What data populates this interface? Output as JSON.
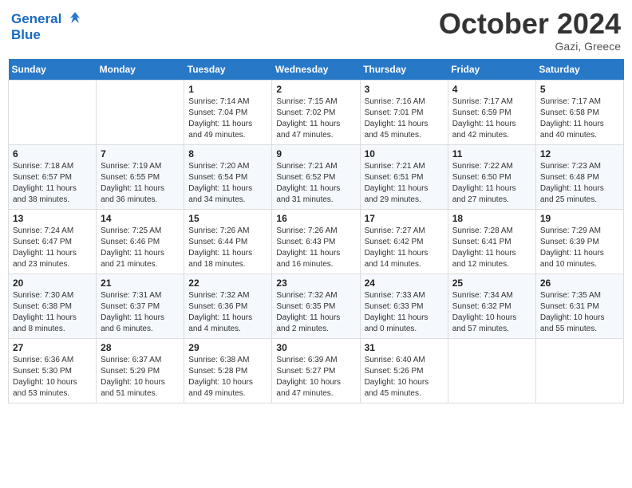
{
  "header": {
    "logo_line1": "General",
    "logo_line2": "Blue",
    "month": "October 2024",
    "location": "Gazi, Greece"
  },
  "weekdays": [
    "Sunday",
    "Monday",
    "Tuesday",
    "Wednesday",
    "Thursday",
    "Friday",
    "Saturday"
  ],
  "weeks": [
    [
      {
        "day": "",
        "info": ""
      },
      {
        "day": "",
        "info": ""
      },
      {
        "day": "1",
        "info": "Sunrise: 7:14 AM\nSunset: 7:04 PM\nDaylight: 11 hours and 49 minutes."
      },
      {
        "day": "2",
        "info": "Sunrise: 7:15 AM\nSunset: 7:02 PM\nDaylight: 11 hours and 47 minutes."
      },
      {
        "day": "3",
        "info": "Sunrise: 7:16 AM\nSunset: 7:01 PM\nDaylight: 11 hours and 45 minutes."
      },
      {
        "day": "4",
        "info": "Sunrise: 7:17 AM\nSunset: 6:59 PM\nDaylight: 11 hours and 42 minutes."
      },
      {
        "day": "5",
        "info": "Sunrise: 7:17 AM\nSunset: 6:58 PM\nDaylight: 11 hours and 40 minutes."
      }
    ],
    [
      {
        "day": "6",
        "info": "Sunrise: 7:18 AM\nSunset: 6:57 PM\nDaylight: 11 hours and 38 minutes."
      },
      {
        "day": "7",
        "info": "Sunrise: 7:19 AM\nSunset: 6:55 PM\nDaylight: 11 hours and 36 minutes."
      },
      {
        "day": "8",
        "info": "Sunrise: 7:20 AM\nSunset: 6:54 PM\nDaylight: 11 hours and 34 minutes."
      },
      {
        "day": "9",
        "info": "Sunrise: 7:21 AM\nSunset: 6:52 PM\nDaylight: 11 hours and 31 minutes."
      },
      {
        "day": "10",
        "info": "Sunrise: 7:21 AM\nSunset: 6:51 PM\nDaylight: 11 hours and 29 minutes."
      },
      {
        "day": "11",
        "info": "Sunrise: 7:22 AM\nSunset: 6:50 PM\nDaylight: 11 hours and 27 minutes."
      },
      {
        "day": "12",
        "info": "Sunrise: 7:23 AM\nSunset: 6:48 PM\nDaylight: 11 hours and 25 minutes."
      }
    ],
    [
      {
        "day": "13",
        "info": "Sunrise: 7:24 AM\nSunset: 6:47 PM\nDaylight: 11 hours and 23 minutes."
      },
      {
        "day": "14",
        "info": "Sunrise: 7:25 AM\nSunset: 6:46 PM\nDaylight: 11 hours and 21 minutes."
      },
      {
        "day": "15",
        "info": "Sunrise: 7:26 AM\nSunset: 6:44 PM\nDaylight: 11 hours and 18 minutes."
      },
      {
        "day": "16",
        "info": "Sunrise: 7:26 AM\nSunset: 6:43 PM\nDaylight: 11 hours and 16 minutes."
      },
      {
        "day": "17",
        "info": "Sunrise: 7:27 AM\nSunset: 6:42 PM\nDaylight: 11 hours and 14 minutes."
      },
      {
        "day": "18",
        "info": "Sunrise: 7:28 AM\nSunset: 6:41 PM\nDaylight: 11 hours and 12 minutes."
      },
      {
        "day": "19",
        "info": "Sunrise: 7:29 AM\nSunset: 6:39 PM\nDaylight: 11 hours and 10 minutes."
      }
    ],
    [
      {
        "day": "20",
        "info": "Sunrise: 7:30 AM\nSunset: 6:38 PM\nDaylight: 11 hours and 8 minutes."
      },
      {
        "day": "21",
        "info": "Sunrise: 7:31 AM\nSunset: 6:37 PM\nDaylight: 11 hours and 6 minutes."
      },
      {
        "day": "22",
        "info": "Sunrise: 7:32 AM\nSunset: 6:36 PM\nDaylight: 11 hours and 4 minutes."
      },
      {
        "day": "23",
        "info": "Sunrise: 7:32 AM\nSunset: 6:35 PM\nDaylight: 11 hours and 2 minutes."
      },
      {
        "day": "24",
        "info": "Sunrise: 7:33 AM\nSunset: 6:33 PM\nDaylight: 11 hours and 0 minutes."
      },
      {
        "day": "25",
        "info": "Sunrise: 7:34 AM\nSunset: 6:32 PM\nDaylight: 10 hours and 57 minutes."
      },
      {
        "day": "26",
        "info": "Sunrise: 7:35 AM\nSunset: 6:31 PM\nDaylight: 10 hours and 55 minutes."
      }
    ],
    [
      {
        "day": "27",
        "info": "Sunrise: 6:36 AM\nSunset: 5:30 PM\nDaylight: 10 hours and 53 minutes."
      },
      {
        "day": "28",
        "info": "Sunrise: 6:37 AM\nSunset: 5:29 PM\nDaylight: 10 hours and 51 minutes."
      },
      {
        "day": "29",
        "info": "Sunrise: 6:38 AM\nSunset: 5:28 PM\nDaylight: 10 hours and 49 minutes."
      },
      {
        "day": "30",
        "info": "Sunrise: 6:39 AM\nSunset: 5:27 PM\nDaylight: 10 hours and 47 minutes."
      },
      {
        "day": "31",
        "info": "Sunrise: 6:40 AM\nSunset: 5:26 PM\nDaylight: 10 hours and 45 minutes."
      },
      {
        "day": "",
        "info": ""
      },
      {
        "day": "",
        "info": ""
      }
    ]
  ]
}
